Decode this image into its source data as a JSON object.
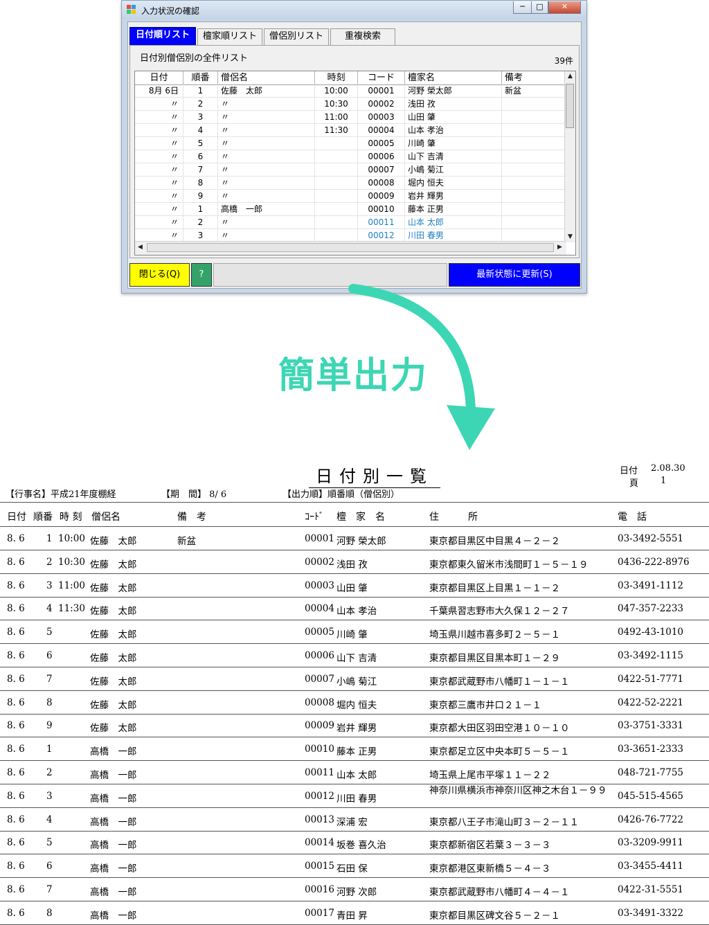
{
  "window": {
    "title": "入力状況の確認",
    "controls": {
      "minimize": "─",
      "maximize": "□",
      "close": "✕"
    },
    "tabs": [
      "日付順リスト",
      "檀家順リスト",
      "僧侶別リスト",
      "重複検索"
    ],
    "active_tab": 0,
    "panel_title": "日付別僧侶別の全件リスト",
    "count": "39件",
    "columns": [
      "日付",
      "順番",
      "僧侶名",
      "時刻",
      "コード",
      "檀家名",
      "備考"
    ],
    "rows": [
      {
        "date": "8月 6日",
        "no": "1",
        "priest": "佐藤　太郎",
        "time": "10:00",
        "code": "00001",
        "name": "河野 榮太郎",
        "note": "新盆"
      },
      {
        "date": "〃",
        "no": "2",
        "priest": "〃",
        "time": "10:30",
        "code": "00002",
        "name": "浅田 孜",
        "note": ""
      },
      {
        "date": "〃",
        "no": "3",
        "priest": "〃",
        "time": "11:00",
        "code": "00003",
        "name": "山田 肇",
        "note": ""
      },
      {
        "date": "〃",
        "no": "4",
        "priest": "〃",
        "time": "11:30",
        "code": "00004",
        "name": "山本 孝治",
        "note": ""
      },
      {
        "date": "〃",
        "no": "5",
        "priest": "〃",
        "time": "",
        "code": "00005",
        "name": "川崎 肇",
        "note": ""
      },
      {
        "date": "〃",
        "no": "6",
        "priest": "〃",
        "time": "",
        "code": "00006",
        "name": "山下 吉清",
        "note": ""
      },
      {
        "date": "〃",
        "no": "7",
        "priest": "〃",
        "time": "",
        "code": "00007",
        "name": "小嶋 菊江",
        "note": ""
      },
      {
        "date": "〃",
        "no": "8",
        "priest": "〃",
        "time": "",
        "code": "00008",
        "name": "堀内 恒夫",
        "note": ""
      },
      {
        "date": "〃",
        "no": "9",
        "priest": "〃",
        "time": "",
        "code": "00009",
        "name": "岩井 輝男",
        "note": ""
      },
      {
        "date": "〃",
        "no": "1",
        "priest": "高橋　一郎",
        "time": "",
        "code": "00010",
        "name": "藤本 正男",
        "note": ""
      },
      {
        "date": "〃",
        "no": "2",
        "priest": "〃",
        "time": "",
        "code": "00011",
        "name": "山本 太郎",
        "note": "",
        "highlight": true
      },
      {
        "date": "〃",
        "no": "3",
        "priest": "〃",
        "time": "",
        "code": "00012",
        "name": "川田 春男",
        "note": "",
        "highlight": true
      }
    ],
    "buttons": {
      "close": "閉じる(Q)",
      "help": "?",
      "refresh": "最新状態に更新(S)"
    },
    "colors": {
      "active_tab": "#0000ff",
      "close_button": "#ffff00",
      "help_button": "#33a36a",
      "refresh_button": "#0000ff",
      "highlight_text": "#1d7fc4"
    }
  },
  "label": {
    "text": "簡単出力",
    "color": "#3dd6b4"
  },
  "report": {
    "title": "日付別一覧",
    "date_label": "日付",
    "date_value": "2.08.30",
    "page_label": "頁",
    "page_value": "1",
    "event": "【行事名】平成21年度棚経",
    "period": "【期　間】 8/ 6",
    "order": "【出力順】順番順（僧侶別）",
    "headers": {
      "date": "日付",
      "no": "順番",
      "time": "時 刻",
      "priest": "僧侶名",
      "note": "備　考",
      "code": "ｺｰﾄﾞ",
      "name": "檀　家　名",
      "address": "住　　　所",
      "phone": "電　話"
    },
    "rows": [
      {
        "date": "8. 6",
        "no": "1",
        "time": "10:00",
        "priest": "佐藤　太郎",
        "note": "新盆",
        "code": "00001",
        "name": "河野 榮太郎",
        "address": "東京都目黒区中目黒４－２－２",
        "phone": "03-3492-5551"
      },
      {
        "date": "8. 6",
        "no": "2",
        "time": "10:30",
        "priest": "佐藤　太郎",
        "note": "",
        "code": "00002",
        "name": "浅田 孜",
        "address": "東京都東久留米市浅間町１－５－１９",
        "phone": "0436-222-8976"
      },
      {
        "date": "8. 6",
        "no": "3",
        "time": "11:00",
        "priest": "佐藤　太郎",
        "note": "",
        "code": "00003",
        "name": "山田 肇",
        "address": "東京都目黒区上目黒１－１－２",
        "phone": "03-3491-1112"
      },
      {
        "date": "8. 6",
        "no": "4",
        "time": "11:30",
        "priest": "佐藤　太郎",
        "note": "",
        "code": "00004",
        "name": "山本 孝治",
        "address": "千葉県習志野市大久保１２－２７",
        "phone": "047-357-2233"
      },
      {
        "date": "8. 6",
        "no": "5",
        "time": "",
        "priest": "佐藤　太郎",
        "note": "",
        "code": "00005",
        "name": "川崎 肇",
        "address": "埼玉県川越市喜多町２－５－１",
        "phone": "0492-43-1010"
      },
      {
        "date": "8. 6",
        "no": "6",
        "time": "",
        "priest": "佐藤　太郎",
        "note": "",
        "code": "00006",
        "name": "山下 吉清",
        "address": "東京都目黒区目黒本町１－２９",
        "phone": "03-3492-1115"
      },
      {
        "date": "8. 6",
        "no": "7",
        "time": "",
        "priest": "佐藤　太郎",
        "note": "",
        "code": "00007",
        "name": "小嶋 菊江",
        "address": "東京都武蔵野市八幡町１－１－１",
        "phone": "0422-51-7771"
      },
      {
        "date": "8. 6",
        "no": "8",
        "time": "",
        "priest": "佐藤　太郎",
        "note": "",
        "code": "00008",
        "name": "堀内 恒夫",
        "address": "東京都三鷹市井口２１－１",
        "phone": "0422-52-2221"
      },
      {
        "date": "8. 6",
        "no": "9",
        "time": "",
        "priest": "佐藤　太郎",
        "note": "",
        "code": "00009",
        "name": "岩井 輝男",
        "address": "東京都大田区羽田空港１０－１０",
        "phone": "03-3751-3331"
      },
      {
        "date": "8. 6",
        "no": "1",
        "time": "",
        "priest": "高橋　一郎",
        "note": "",
        "code": "00010",
        "name": "藤本 正男",
        "address": "東京都足立区中央本町５－５－１",
        "phone": "03-3651-2333"
      },
      {
        "date": "8. 6",
        "no": "2",
        "time": "",
        "priest": "高橋　一郎",
        "note": "",
        "code": "00011",
        "name": "山本 太郎",
        "address": "埼玉県上尾市平塚１１－２２",
        "phone": "048-721-7755"
      },
      {
        "date": "8. 6",
        "no": "3",
        "time": "",
        "priest": "高橋　一郎",
        "note": "",
        "code": "00012",
        "name": "川田 春男",
        "address": "神奈川県横浜市神奈川区神之木台１－９９",
        "phone": "045-515-4565",
        "wrap": true
      },
      {
        "date": "8. 6",
        "no": "4",
        "time": "",
        "priest": "高橋　一郎",
        "note": "",
        "code": "00013",
        "name": "深浦 宏",
        "address": "東京都八王子市滝山町３－２－１１",
        "phone": "0426-76-7722"
      },
      {
        "date": "8. 6",
        "no": "5",
        "time": "",
        "priest": "高橋　一郎",
        "note": "",
        "code": "00014",
        "name": "坂巻 喜久治",
        "address": "東京都新宿区若葉３－３－３",
        "phone": "03-3209-9911"
      },
      {
        "date": "8. 6",
        "no": "6",
        "time": "",
        "priest": "高橋　一郎",
        "note": "",
        "code": "00015",
        "name": "石田 保",
        "address": "東京都港区東新橋５－４－３",
        "phone": "03-3455-4411"
      },
      {
        "date": "8. 6",
        "no": "7",
        "time": "",
        "priest": "高橋　一郎",
        "note": "",
        "code": "00016",
        "name": "河野 次郎",
        "address": "東京都武蔵野市八幡町４－４－１",
        "phone": "0422-31-5551"
      },
      {
        "date": "8. 6",
        "no": "8",
        "time": "",
        "priest": "高橋　一郎",
        "note": "",
        "code": "00017",
        "name": "青田 昇",
        "address": "東京都目黒区碑文谷５－２－１",
        "phone": "03-3491-3322"
      }
    ]
  }
}
